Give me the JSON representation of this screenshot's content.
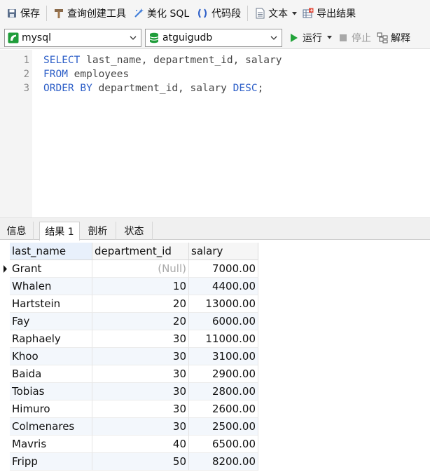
{
  "toolbar": {
    "save_label": "保存",
    "query_builder_label": "查询创建工具",
    "beautify_label": "美化 SQL",
    "snippet_label": "代码段",
    "text_label": "文本",
    "export_label": "导出结果"
  },
  "connection": {
    "server": "mysql",
    "database": "atguigudb",
    "run_label": "运行",
    "stop_label": "停止",
    "explain_label": "解释"
  },
  "editor": {
    "lines": [
      {
        "num": "1",
        "tokens": [
          {
            "t": "SELECT",
            "k": true
          },
          {
            "t": " last_name, department_id, salary",
            "k": false
          }
        ]
      },
      {
        "num": "2",
        "tokens": [
          {
            "t": "FROM",
            "k": true
          },
          {
            "t": " employees",
            "k": false
          }
        ]
      },
      {
        "num": "3",
        "tokens": [
          {
            "t": "ORDER BY",
            "k": true
          },
          {
            "t": " department_id, salary ",
            "k": false
          },
          {
            "t": "DESC",
            "k": true
          },
          {
            "t": ";",
            "k": false
          }
        ]
      }
    ]
  },
  "tabs": [
    {
      "label": "信息",
      "active": false
    },
    {
      "label": "结果 1",
      "active": true
    },
    {
      "label": "剖析",
      "active": false
    },
    {
      "label": "状态",
      "active": false
    }
  ],
  "grid": {
    "columns": [
      "last_name",
      "department_id",
      "salary"
    ],
    "null_text": "(Null)",
    "rows": [
      [
        "Grant",
        null,
        "7000.00"
      ],
      [
        "Whalen",
        "10",
        "4400.00"
      ],
      [
        "Hartstein",
        "20",
        "13000.00"
      ],
      [
        "Fay",
        "20",
        "6000.00"
      ],
      [
        "Raphaely",
        "30",
        "11000.00"
      ],
      [
        "Khoo",
        "30",
        "3100.00"
      ],
      [
        "Baida",
        "30",
        "2900.00"
      ],
      [
        "Tobias",
        "30",
        "2800.00"
      ],
      [
        "Himuro",
        "30",
        "2600.00"
      ],
      [
        "Colmenares",
        "30",
        "2500.00"
      ],
      [
        "Mavris",
        "40",
        "6500.00"
      ],
      [
        "Fripp",
        "50",
        "8200.00"
      ]
    ]
  },
  "colors": {
    "keyword": "#2f60c8",
    "run_green": "#22a33a",
    "db_green": "#1f9d3a",
    "alt_row": "#f3f7fc"
  }
}
